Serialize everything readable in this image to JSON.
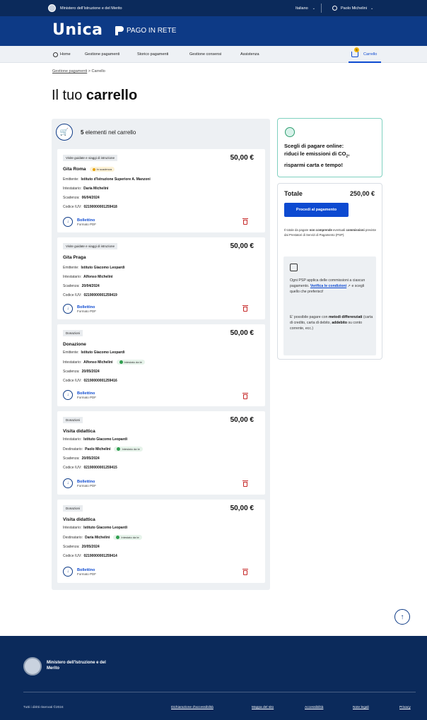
{
  "topbar": {
    "org": "Ministero dell'Istruzione e del Merito",
    "language": "Italiano",
    "user": "Paolo Michelini"
  },
  "brand": {
    "logo": "Unica",
    "pago": "PAGO IN RETE"
  },
  "nav": {
    "home": "Home",
    "items": [
      "Gestione pagamenti",
      "Storico pagamenti",
      "Gestione consensi",
      "Assistenza"
    ],
    "cart": "Carrello",
    "cart_count": "5"
  },
  "breadcrumb": {
    "parent": "Gestione pagamenti",
    "sep": ">",
    "current": "Carrello"
  },
  "page_title": {
    "light": "Il tuo",
    "bold": "carrello"
  },
  "cart": {
    "count_bold": "5",
    "count_rest": "elementi nel carrello",
    "items": [
      {
        "tag": "Visite guidate e viaggi di istruzione",
        "amount": "50,00 €",
        "name": "Gita Roma",
        "badge": "In scadenza",
        "l1_label": "Emittente:",
        "l1_value": "Istituto d'Istruzione Superiore A. Manzoni",
        "l2_label": "Intestatario:",
        "l2_value": "Daria Michelini",
        "l2_badge": "",
        "l3_label": "Scadenza:",
        "l3_value": "06/04/2024",
        "l4_label": "Codice IUV:",
        "l4_value": "02190000001259418",
        "dl_title": "Bollettino",
        "dl_format": "Formato PDF"
      },
      {
        "tag": "Visite guidate e viaggi di istruzione",
        "amount": "50,00 €",
        "name": "Gita Praga",
        "badge": "",
        "l1_label": "Emittente:",
        "l1_value": "Istituto Giacomo Leopardi",
        "l2_label": "Intestatario:",
        "l2_value": "Alfonso Michelini",
        "l2_badge": "",
        "l3_label": "Scadenza:",
        "l3_value": "20/04/2024",
        "l4_label": "Codice IUV:",
        "l4_value": "02190000001259419",
        "dl_title": "Bollettino",
        "dl_format": "Formato PDF"
      },
      {
        "tag": "Donazioni",
        "amount": "50,00 €",
        "name": "Donazione",
        "badge": "",
        "l1_label": "Emittente:",
        "l1_value": "Istituto Giacomo Leopardi",
        "l2_label": "Intestatario:",
        "l2_value": "Alfonso Michelini",
        "l2_badge": "Intestato da te",
        "l3_label": "Scadenza:",
        "l3_value": "20/05/2024",
        "l4_label": "Codice IUV:",
        "l4_value": "02190000001259416",
        "dl_title": "Bollettino",
        "dl_format": "Formato PDF"
      },
      {
        "tag": "Donazioni",
        "amount": "50,00 €",
        "name": "Visita didattica",
        "badge": "",
        "l1_label": "Intestatario:",
        "l1_value": "Istituto Giacomo Leopardi",
        "l2_label": "Destinatario:",
        "l2_value": "Paolo Michelini",
        "l2_badge": "Intestato da te",
        "l3_label": "Scadenza:",
        "l3_value": "20/05/2024",
        "l4_label": "Codice IUV:",
        "l4_value": "02190000001259415",
        "dl_title": "Bollettino",
        "dl_format": "Formato PDF"
      },
      {
        "tag": "Donazioni",
        "amount": "50,00 €",
        "name": "Visita didattica",
        "badge": "",
        "l1_label": "Intestatario:",
        "l1_value": "Istituto Giacomo Leopardi",
        "l2_label": "Destinatario:",
        "l2_value": "Daria Michelini",
        "l2_badge": "Intestato da te",
        "l3_label": "Scadenza:",
        "l3_value": "20/05/2024",
        "l4_label": "Codice IUV:",
        "l4_value": "02190000001259414",
        "dl_title": "Bollettino",
        "dl_format": "Formato PDF"
      }
    ]
  },
  "promo": {
    "line1": "Scegli di pagare online:",
    "line2a": "riduci le emissioni di CO",
    "line2sub": "2",
    "line2b": ",",
    "line3": "risparmi carta e tempo!"
  },
  "summary": {
    "total_label": "Totale",
    "total_value": "250,00 €",
    "pay_button": "Procedi al pagamento",
    "note_a": "Il totale da pagare",
    "note_b": "non comprende",
    "note_c": "eventuali",
    "note_d": "commissioni",
    "note_e": "previste dai Prestatori di Servizi di Pagamento (PSP).",
    "psp_p1a": "Ogni PSP applica delle commissioni a ciascun pagamento.",
    "psp_link": "Verifica le condizioni",
    "psp_p1b": "e scegli quello che preferisci!",
    "psp_p2a": "E' possibile pagare con",
    "psp_p2b": "metodi differenziati",
    "psp_p2c": "(carta di credito, carta di debito,",
    "psp_p2d": "addebito",
    "psp_p2e": "su conto corrente, ecc.)"
  },
  "footer": {
    "org": "Ministero dell'Istruzione e del Merito",
    "copyright": "Tutti i diritti riservati ©2024",
    "links": [
      "Dichiarazione d'accessibilità",
      "Mappa del sito",
      "Accessibilità",
      "Note legali",
      "Privacy"
    ]
  },
  "colors": {
    "navy": "#0b2a5b",
    "brand": "#0d3a86",
    "accent": "#0d4ad1",
    "danger": "#c62828",
    "warn": "#e6a100",
    "ok": "#2f9e4f"
  }
}
